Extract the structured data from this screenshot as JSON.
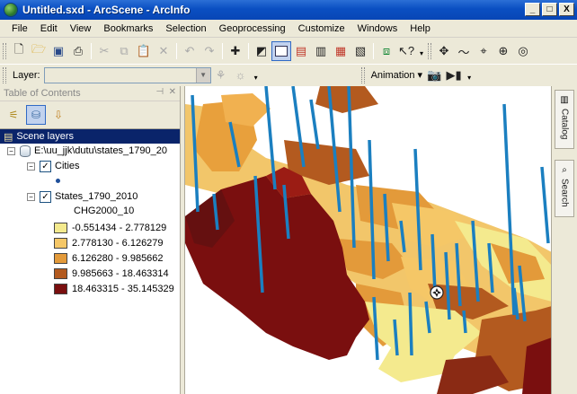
{
  "window": {
    "title": "Untitled.sxd - ArcScene - ArcInfo",
    "min_label": "_",
    "max_label": "□",
    "close_label": "X"
  },
  "menu": [
    "File",
    "Edit",
    "View",
    "Bookmarks",
    "Selection",
    "Geoprocessing",
    "Customize",
    "Windows",
    "Help"
  ],
  "layer_toolbar": {
    "label": "Layer:",
    "value": "",
    "animation_label": "Animation ▾"
  },
  "toc": {
    "title": "Table of Contents",
    "scene_layers_label": "Scene layers",
    "workspace_path": "E:\\uu_jjk\\dutu\\states_1790_20",
    "cities_label": "Cities",
    "states_label": "States_1790_2010",
    "field_label": "CHG2000_10",
    "legend": [
      {
        "label": "-0.551434 - 2.778129",
        "color": "#f4ea8e"
      },
      {
        "label": "2.778130 - 6.126279",
        "color": "#f5c767"
      },
      {
        "label": "6.126280 - 9.985662",
        "color": "#e39a3a"
      },
      {
        "label": "9.985663 - 18.463314",
        "color": "#b35a1f"
      },
      {
        "label": "18.463315 - 35.145329",
        "color": "#7a0f0f"
      }
    ]
  },
  "side_tabs": {
    "catalog": "Catalog",
    "search": "Search"
  },
  "colors": {
    "selection": "#0a246a",
    "bar_blue": "#1b7fc0"
  }
}
